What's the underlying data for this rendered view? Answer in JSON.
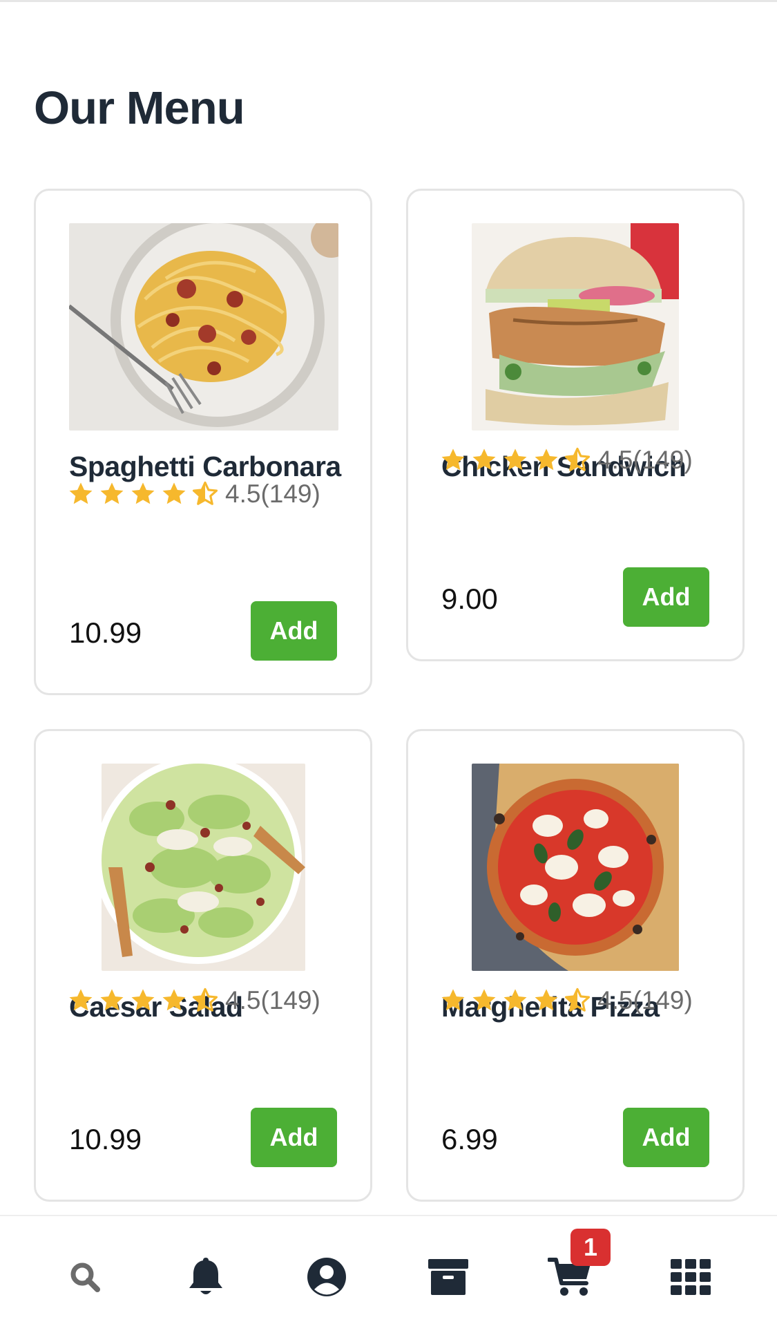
{
  "page": {
    "title": "Our Menu"
  },
  "menu_items": [
    {
      "name": "Spaghetti Carbonara",
      "rating_score": "4.5",
      "rating_count": "(149)",
      "stars": 4.5,
      "price": "10.99",
      "add_label": "Add"
    },
    {
      "name": "Chicken Sandwich",
      "rating_score": "4.5",
      "rating_count": "(149)",
      "stars": 4.5,
      "price": "9.00",
      "add_label": "Add"
    },
    {
      "name": "Caesar Salad",
      "rating_score": "4.5",
      "rating_count": "(149)",
      "stars": 4.5,
      "price": "10.99",
      "add_label": "Add"
    },
    {
      "name": "Margherita Pizza",
      "rating_score": "4.5",
      "rating_count": "(149)",
      "stars": 4.5,
      "price": "6.99",
      "add_label": "Add"
    }
  ],
  "bottom_nav": {
    "items": [
      {
        "icon": "search-icon"
      },
      {
        "icon": "bell-icon"
      },
      {
        "icon": "user-circle-icon"
      },
      {
        "icon": "archive-box-icon"
      },
      {
        "icon": "cart-icon"
      },
      {
        "icon": "grid-icon"
      }
    ],
    "cart_badge": "1"
  },
  "colors": {
    "accent_green": "#4caf35",
    "star_yellow": "#f6b82d",
    "badge_red": "#d93030",
    "title_text": "#1f2a37"
  }
}
